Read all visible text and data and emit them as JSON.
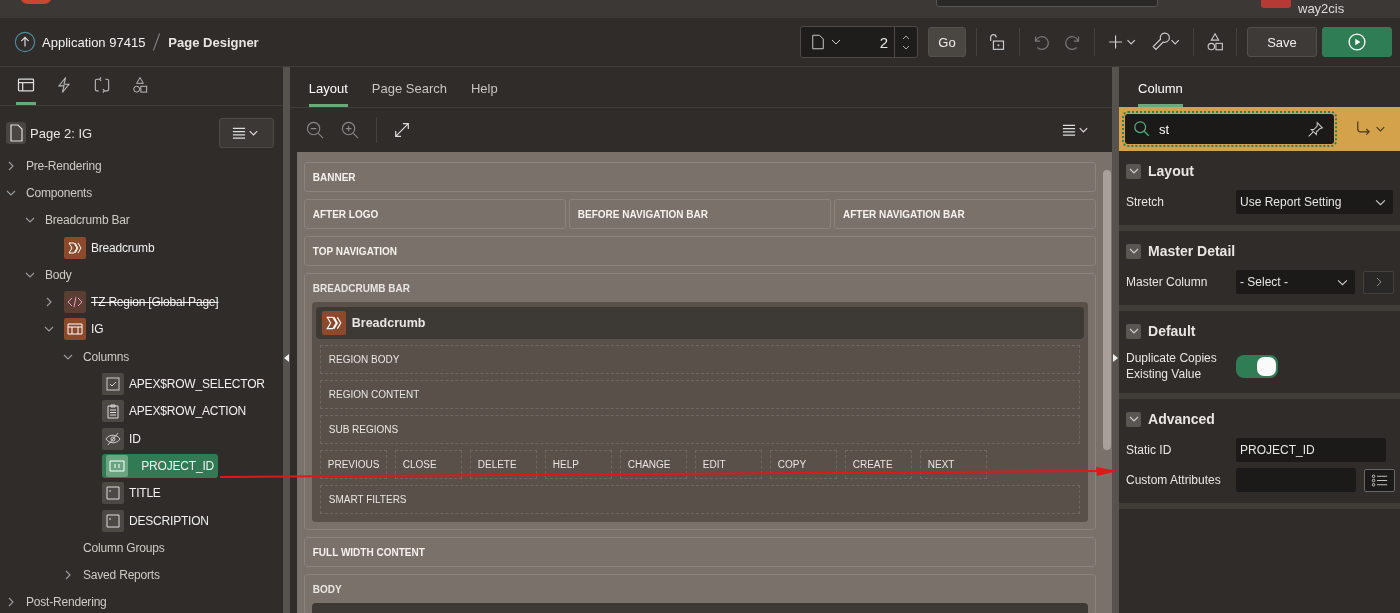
{
  "top_bar": {
    "user": "way2cis"
  },
  "header": {
    "app": "Application 97415",
    "page_title": "Page Designer",
    "page_number": "2",
    "go": "Go",
    "save": "Save"
  },
  "left_panel": {
    "tabs": [
      {
        "kind": "rendering",
        "selected": true
      },
      {
        "kind": "dynamic-actions",
        "selected": false
      },
      {
        "kind": "processing",
        "selected": false
      },
      {
        "kind": "shared",
        "selected": false
      }
    ],
    "page_label": "Page 2: IG",
    "tree": [
      {
        "label": "Pre-Rendering",
        "expanded": false
      },
      {
        "label": "Components",
        "expanded": true,
        "children": [
          {
            "label": "Breadcrumb Bar",
            "expanded": true,
            "children": [
              {
                "label": "Breadcrumb",
                "kind": "breadcrumb"
              }
            ]
          },
          {
            "label": "Body",
            "expanded": true,
            "children": [
              {
                "label": "TZ Region [Global Page]",
                "expanded": false,
                "kind": "code",
                "disabled": true
              },
              {
                "label": "IG",
                "expanded": true,
                "kind": "grid",
                "children": [
                  {
                    "label": "Columns",
                    "expanded": true,
                    "children": [
                      {
                        "label": "APEX$ROW_SELECTOR",
                        "kind": "checkbox",
                        "selected": false
                      },
                      {
                        "label": "APEX$ROW_ACTION",
                        "kind": "clipboard",
                        "selected": false
                      },
                      {
                        "label": "ID",
                        "kind": "hidden",
                        "selected": false
                      },
                      {
                        "label": "PROJECT_ID",
                        "kind": "number",
                        "selected": true
                      },
                      {
                        "label": "TITLE",
                        "kind": "text",
                        "selected": false
                      },
                      {
                        "label": "DESCRIPTION",
                        "kind": "text",
                        "selected": false
                      }
                    ]
                  },
                  {
                    "label": "Column Groups"
                  },
                  {
                    "label": "Saved Reports",
                    "expanded": false
                  }
                ]
              }
            ]
          }
        ]
      },
      {
        "label": "Post-Rendering",
        "expanded": false
      }
    ]
  },
  "center": {
    "tabs": [
      {
        "label": "Layout",
        "selected": true
      },
      {
        "label": "Page Search",
        "selected": false
      },
      {
        "label": "Help",
        "selected": false
      }
    ],
    "layout": [
      {
        "kind": "row",
        "cells": [
          "BANNER"
        ]
      },
      {
        "kind": "row",
        "cells": [
          "AFTER LOGO",
          "BEFORE NAVIGATION BAR",
          "AFTER NAVIGATION BAR"
        ]
      },
      {
        "kind": "row",
        "cells": [
          "TOP NAVIGATION"
        ]
      },
      {
        "kind": "group",
        "label": "BREADCRUMB BAR",
        "region": {
          "title": "Breadcrumb",
          "items": [
            {
              "kind": "slot",
              "label": "REGION BODY"
            },
            {
              "kind": "slot",
              "label": "REGION CONTENT"
            },
            {
              "kind": "slot",
              "label": "SUB REGIONS"
            },
            {
              "kind": "buttons",
              "labels": [
                "PREVIOUS",
                "CLOSE",
                "DELETE",
                "HELP",
                "CHANGE",
                "EDIT",
                "COPY",
                "CREATE",
                "NEXT"
              ]
            },
            {
              "kind": "slot",
              "label": "SMART FILTERS"
            }
          ]
        }
      },
      {
        "kind": "row",
        "cells": [
          "FULL WIDTH CONTENT"
        ]
      },
      {
        "kind": "cut",
        "label": "BODY"
      }
    ]
  },
  "right_panel": {
    "tabs": [
      {
        "label": "Column",
        "selected": true
      }
    ],
    "search_value": "st",
    "sections": [
      {
        "title": "Layout",
        "expanded": true,
        "properties": [
          {
            "label": "Stretch",
            "kind": "select",
            "value": "Use Report Setting"
          }
        ]
      },
      {
        "title": "Master Detail",
        "expanded": true,
        "properties": [
          {
            "label": "Master Column",
            "kind": "select-link",
            "value": "- Select -"
          }
        ]
      },
      {
        "title": "Default",
        "expanded": true,
        "properties": [
          {
            "label": "Duplicate Copies Existing Value",
            "kind": "switch",
            "on": true
          }
        ]
      },
      {
        "title": "Advanced",
        "expanded": true,
        "properties": [
          {
            "label": "Static ID",
            "kind": "text",
            "value": "PROJECT_ID"
          },
          {
            "label": "Custom Attributes",
            "kind": "text-list"
          }
        ]
      }
    ]
  }
}
